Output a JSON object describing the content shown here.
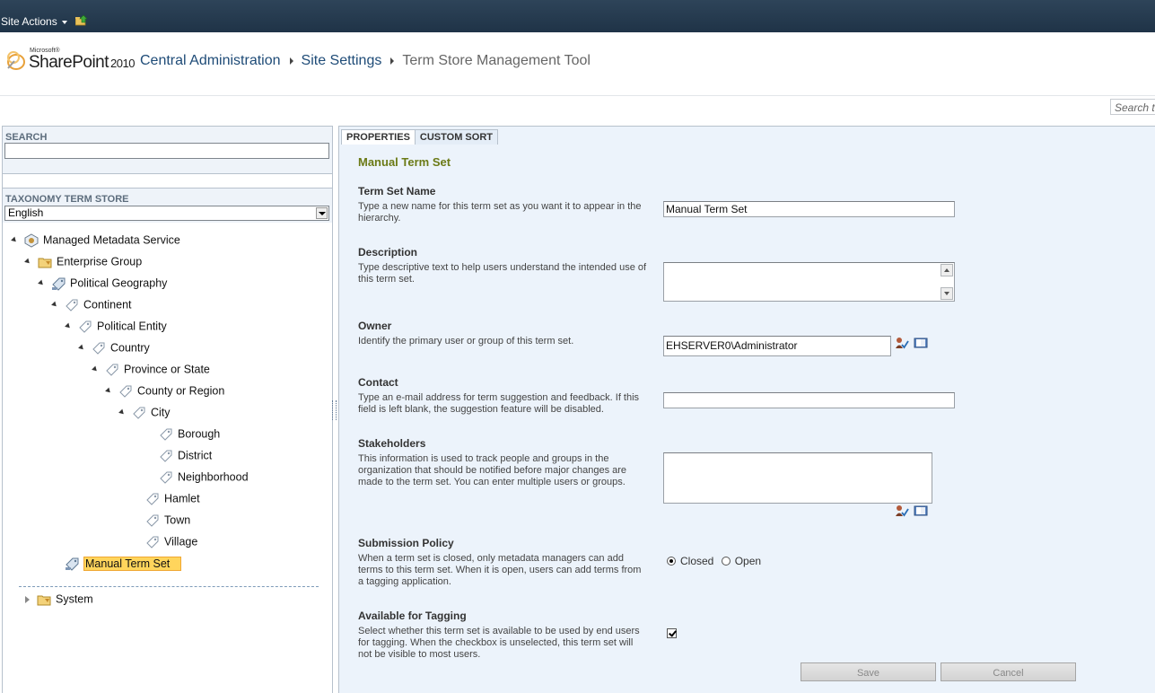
{
  "topbar": {
    "site_actions": "Site Actions"
  },
  "header": {
    "logo_small": "Microsoft®",
    "logo_name": "SharePoint",
    "logo_year": "2010",
    "breadcrumb": [
      "Central Administration",
      "Site Settings",
      "Term Store Management Tool"
    ]
  },
  "top_search": {
    "placeholder": "Search t"
  },
  "left": {
    "search_label": "SEARCH",
    "taxonomy_label": "TAXONOMY TERM STORE",
    "language": "English",
    "tree": [
      {
        "label": "Managed Metadata Service",
        "icon": "service-icon",
        "toggle": "expanded"
      },
      {
        "label": "Enterprise Group",
        "icon": "group-folder-icon",
        "toggle": "expanded"
      },
      {
        "label": "Political Geography",
        "icon": "termset-icon",
        "toggle": "expanded"
      },
      {
        "label": "Continent",
        "icon": "term-tag-icon",
        "toggle": "expanded"
      },
      {
        "label": "Political Entity",
        "icon": "term-tag-icon",
        "toggle": "expanded"
      },
      {
        "label": "Country",
        "icon": "term-tag-icon",
        "toggle": "expanded"
      },
      {
        "label": "Province or State",
        "icon": "term-tag-icon",
        "toggle": "expanded"
      },
      {
        "label": "County or Region",
        "icon": "term-tag-icon",
        "toggle": "expanded"
      },
      {
        "label": "City",
        "icon": "term-tag-icon",
        "toggle": "expanded"
      },
      {
        "label": "Borough",
        "icon": "term-tag-icon",
        "toggle": "none"
      },
      {
        "label": "District",
        "icon": "term-tag-icon",
        "toggle": "none"
      },
      {
        "label": "Neighborhood",
        "icon": "term-tag-icon",
        "toggle": "none"
      },
      {
        "label": "Hamlet",
        "icon": "term-tag-icon",
        "toggle": "none"
      },
      {
        "label": "Town",
        "icon": "term-tag-icon",
        "toggle": "none"
      },
      {
        "label": "Village",
        "icon": "term-tag-icon",
        "toggle": "none"
      },
      {
        "label": "Manual Term Set",
        "icon": "termset-icon",
        "toggle": "none",
        "selected": true
      },
      {
        "label": "System",
        "icon": "group-folder-icon",
        "toggle": "collapsed"
      }
    ]
  },
  "right": {
    "tabs": [
      "PROPERTIES",
      "CUSTOM SORT"
    ],
    "form_title": "Manual Term Set",
    "term_set_name": {
      "title": "Term Set Name",
      "desc": "Type a new name for this term set as you want it to appear in the hierarchy.",
      "value": "Manual Term Set"
    },
    "description": {
      "title": "Description",
      "desc": "Type descriptive text to help users understand the intended use of this term set.",
      "value": ""
    },
    "owner": {
      "title": "Owner",
      "desc": "Identify the primary user or group of this term set.",
      "value": "EHSERVER0\\Administrator"
    },
    "contact": {
      "title": "Contact",
      "desc": "Type an e-mail address for term suggestion and feedback. If this field is left blank, the suggestion feature will be disabled.",
      "value": ""
    },
    "stakeholders": {
      "title": "Stakeholders",
      "desc": "This information is used to track people and groups in the organization that should be notified before major changes are made to the term set. You can enter multiple users or groups.",
      "value": ""
    },
    "submission": {
      "title": "Submission Policy",
      "desc": "When a term set is closed, only metadata managers can add terms to this term set. When it is open, users can add terms from a tagging application.",
      "closed_label": "Closed",
      "open_label": "Open",
      "selected": "Closed"
    },
    "tagging": {
      "title": "Available for Tagging",
      "desc": "Select whether this term set is available to be used by end users for tagging. When the checkbox is unselected, this term set will not be visible to most users.",
      "checked": true
    },
    "buttons": {
      "save": "Save",
      "cancel": "Cancel"
    }
  },
  "colors": {
    "topbar": "#1f3347",
    "form_title": "#6b7a16",
    "breadcrumb": "#1e4b77",
    "selected": "#ffd55c"
  }
}
